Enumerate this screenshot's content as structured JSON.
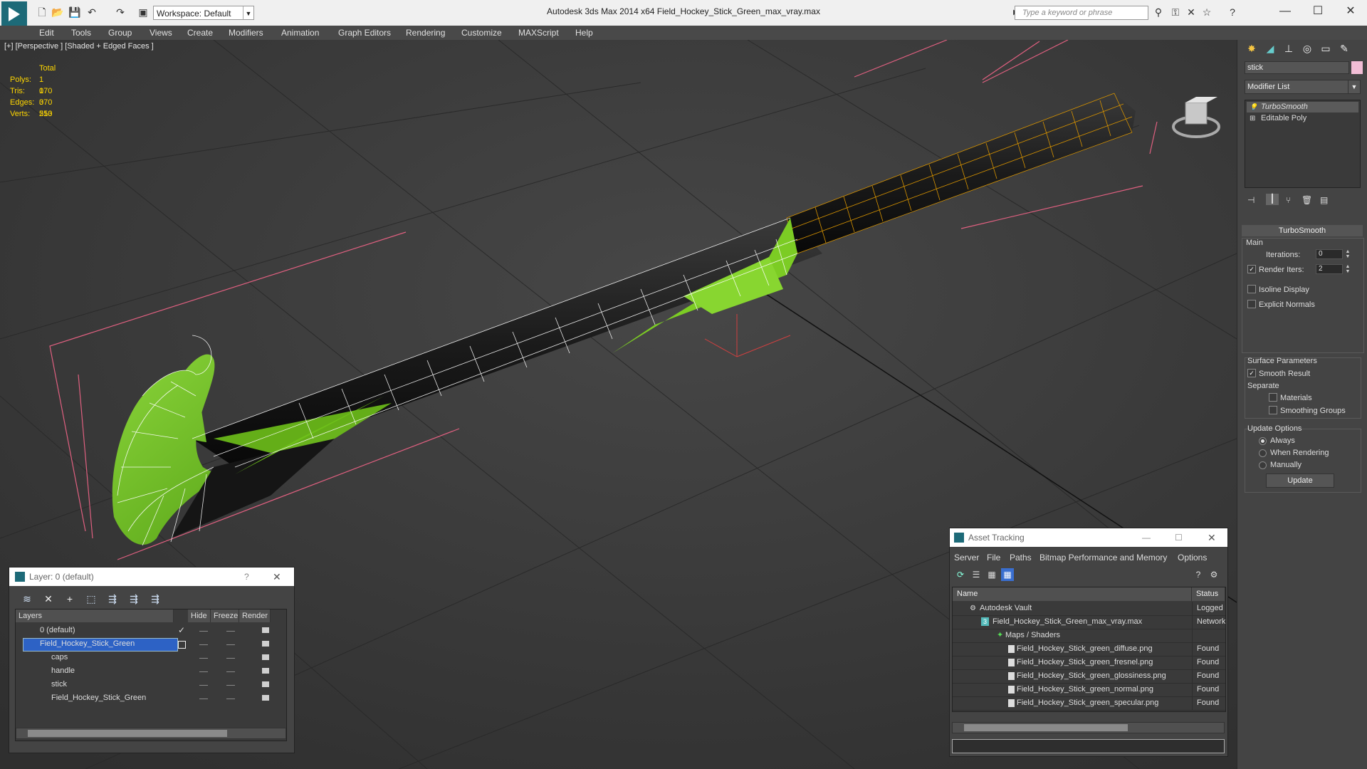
{
  "app": {
    "title": "Autodesk 3ds Max  2014 x64      Field_Hockey_Stick_Green_max_vray.max",
    "workspace": "Workspace: Default",
    "search_placeholder": "Type a keyword or phrase"
  },
  "menu": [
    "Edit",
    "Tools",
    "Group",
    "Views",
    "Create",
    "Modifiers",
    "Animation",
    "Graph Editors",
    "Rendering",
    "Customize",
    "MAXScript",
    "Help"
  ],
  "viewport": {
    "label": "[+] [Perspective ] [Shaded + Edged Faces ]",
    "stats": {
      "header": "Total",
      "rows": [
        {
          "key": "Polys:",
          "value": "1 070"
        },
        {
          "key": "Tris:",
          "value": "1 070"
        },
        {
          "key": "Edges:",
          "value": "3 210"
        },
        {
          "key": "Verts:",
          "value": "553"
        }
      ]
    },
    "colors": {
      "mesh_green": "#6ec01a",
      "mesh_dark": "#151515",
      "wire": "#ffffff",
      "selection": "#e8a000",
      "bbox": "#e06080"
    }
  },
  "command_panel": {
    "object_name": "stick",
    "object_color": "#f2bed6",
    "modifier_list": "Modifier List",
    "stack": [
      "TurboSmooth",
      "Editable Poly"
    ],
    "rollout": "TurboSmooth",
    "main_label": "Main",
    "iterations_label": "Iterations:",
    "iterations_value": "0",
    "render_iters_label": "Render Iters:",
    "render_iters_value": "2",
    "isoline_label": "Isoline Display",
    "explicit_label": "Explicit Normals",
    "surface_label": "Surface Parameters",
    "smooth_label": "Smooth Result",
    "separate_label": "Separate",
    "materials_label": "Materials",
    "smoothing_label": "Smoothing Groups",
    "update_label": "Update Options",
    "always_label": "Always",
    "when_render_label": "When Rendering",
    "manually_label": "Manually",
    "update_button": "Update"
  },
  "layer_dialog": {
    "title": "Layer: 0 (default)",
    "help": "?",
    "columns": [
      "Layers",
      "Hide",
      "Freeze",
      "Render"
    ],
    "rows": [
      {
        "name": "0 (default)",
        "indent": 0
      },
      {
        "name": "Field_Hockey_Stick_Green",
        "indent": 0
      },
      {
        "name": "caps",
        "indent": 1
      },
      {
        "name": "handle",
        "indent": 1
      },
      {
        "name": "stick",
        "indent": 1
      },
      {
        "name": "Field_Hockey_Stick_Green",
        "indent": 1
      }
    ]
  },
  "asset_dialog": {
    "title": "Asset Tracking",
    "menu": [
      "Server",
      "File",
      "Paths",
      "Bitmap Performance and Memory",
      "Options"
    ],
    "columns": [
      "Name",
      "Status"
    ],
    "rows": [
      {
        "name": "Autodesk Vault",
        "status": "Logged Out",
        "indent": 1
      },
      {
        "name": "Field_Hockey_Stick_Green_max_vray.max",
        "status": "Network",
        "indent": 2
      },
      {
        "name": "Maps / Shaders",
        "status": "",
        "indent": 3
      },
      {
        "name": "Field_Hockey_Stick_green_diffuse.png",
        "status": "Found",
        "indent": 4
      },
      {
        "name": "Field_Hockey_Stick_green_fresnel.png",
        "status": "Found",
        "indent": 4
      },
      {
        "name": "Field_Hockey_Stick_green_glossiness.png",
        "status": "Found",
        "indent": 4
      },
      {
        "name": "Field_Hockey_Stick_green_normal.png",
        "status": "Found",
        "indent": 4
      },
      {
        "name": "Field_Hockey_Stick_green_specular.png",
        "status": "Found",
        "indent": 4
      }
    ]
  }
}
